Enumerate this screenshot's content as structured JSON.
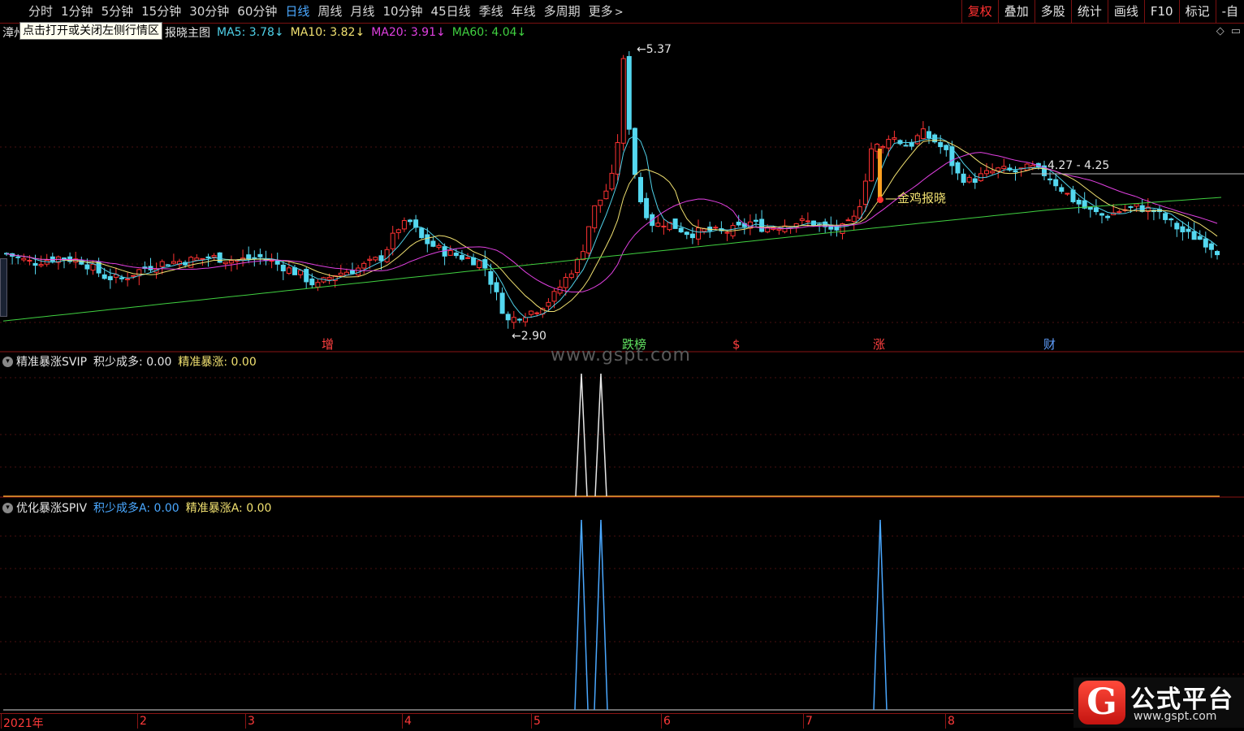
{
  "toolbar": {
    "periods": [
      "分时",
      "1分钟",
      "5分钟",
      "15分钟",
      "30分钟",
      "60分钟",
      "日线",
      "周线",
      "月线",
      "10分钟",
      "45日线",
      "季线",
      "年线",
      "多周期",
      "更多"
    ],
    "active_period": "日线",
    "right_buttons": [
      "复权",
      "叠加",
      "多股",
      "统计",
      "画线",
      "F10",
      "标记",
      "-自"
    ]
  },
  "main_panel": {
    "stock_name": "漳州",
    "tooltip": "点击打开或关闭左侧行情区",
    "formula_name": "报晓主图",
    "ma": [
      {
        "label": "MA5: 3.78",
        "arrow": "↓",
        "color": "#4fd0e8"
      },
      {
        "label": "MA10: 3.82",
        "arrow": "↓",
        "color": "#f0e070"
      },
      {
        "label": "MA20: 3.91",
        "arrow": "↓",
        "color": "#e040e0"
      },
      {
        "label": "MA60: 4.04",
        "arrow": "↓",
        "color": "#40d040"
      }
    ],
    "high_label": "5.37",
    "low_label": "2.90",
    "range_label": "4.27 - 4.25",
    "signal_label": "金鸡报晓",
    "event_marks": [
      {
        "text": "增",
        "color": "#ff4040"
      },
      {
        "text": "跌榜",
        "color": "#60e060"
      },
      {
        "text": "$",
        "color": "#ff4040"
      },
      {
        "text": "涨",
        "color": "#ff4040"
      },
      {
        "text": "财",
        "color": "#60a0ff"
      }
    ]
  },
  "indicator1": {
    "name": "精准暴涨SVIP",
    "v1_label": "积少成多: 0.00",
    "v2_label": "精准暴涨: 0.00"
  },
  "indicator2": {
    "name": "优化暴涨SPIV",
    "v1_label": "积少成多A: 0.00",
    "v2_label": "精准暴涨A: 0.00"
  },
  "watermark": "www.gspt.com",
  "date_axis": [
    "2021年",
    "2",
    "3",
    "4",
    "5",
    "6",
    "7",
    "8"
  ],
  "logo": {
    "letter": "G",
    "title": "公式平台",
    "url": "www.gspt.com"
  },
  "colors": {
    "up": "#ff3232",
    "down": "#54d8f0",
    "ma5": "#4fd0e8",
    "ma10": "#f0e070",
    "ma20": "#e040e0",
    "ma60": "#40d040",
    "grid": "#8a1515"
  }
}
